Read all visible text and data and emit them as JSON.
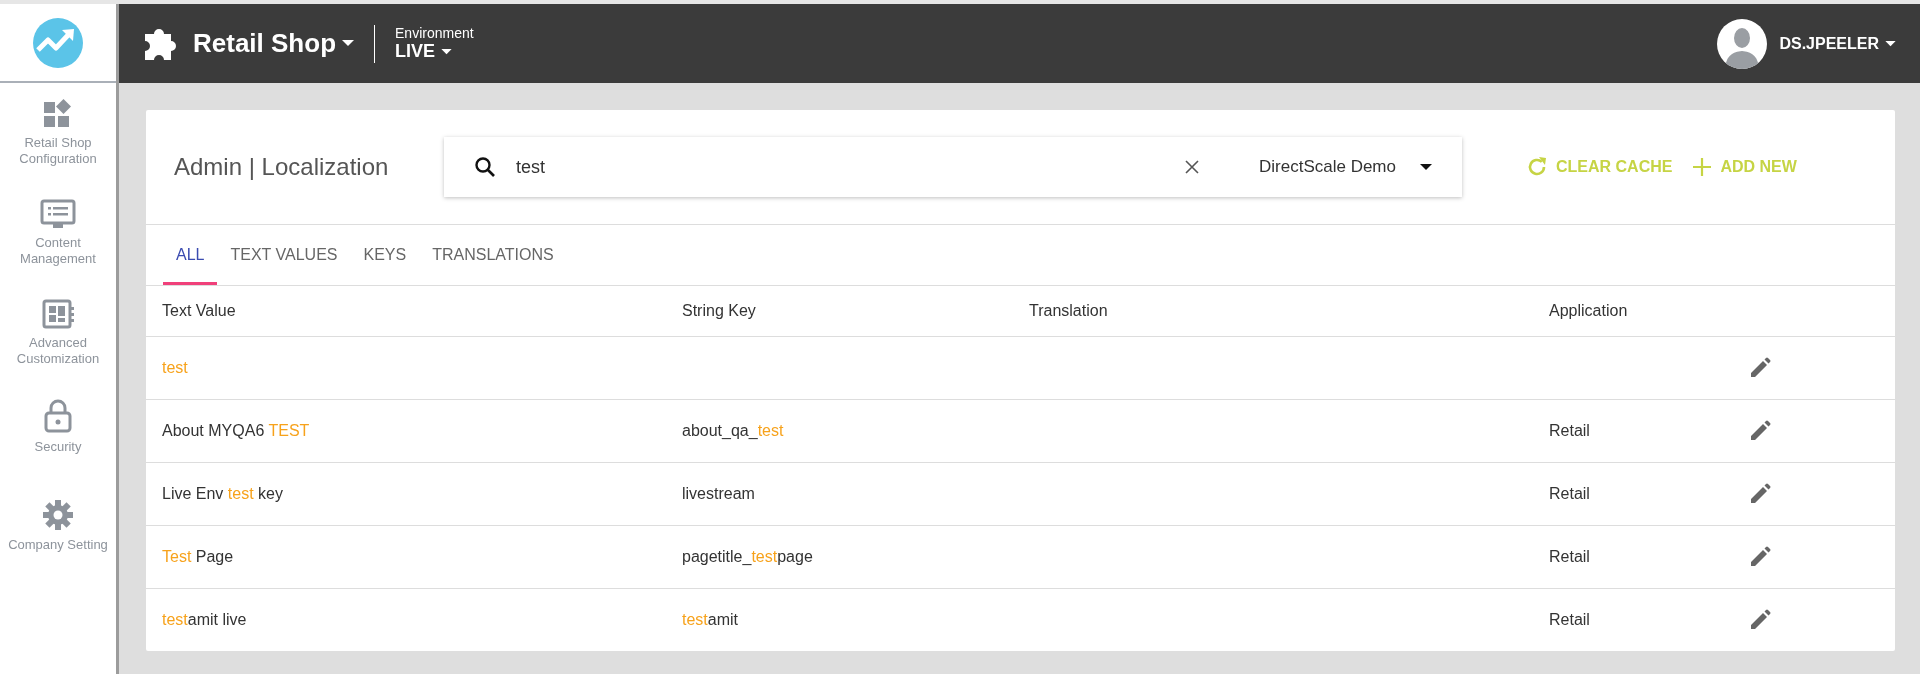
{
  "sidebar": {
    "items": [
      {
        "kind": "widgets",
        "label": "Retail Shop Configuration"
      },
      {
        "kind": "monitor",
        "label": "Content Management"
      },
      {
        "kind": "dashboard",
        "label": "Advanced Customization"
      },
      {
        "kind": "lock",
        "label": "Security"
      },
      {
        "kind": "gear",
        "label": "Company Setting"
      }
    ]
  },
  "header": {
    "app_name": "Retail Shop",
    "environment_label": "Environment",
    "environment": "LIVE",
    "user": "DS.JPEELER"
  },
  "page": {
    "title": "Admin | Localization",
    "search": {
      "value": "test"
    },
    "company_select": "DirectScale Demo",
    "actions": [
      {
        "kind": "refresh",
        "label": "CLEAR CACHE"
      },
      {
        "kind": "add",
        "label": "ADD NEW"
      }
    ]
  },
  "tabs": [
    {
      "label": "ALL",
      "selected": true
    },
    {
      "label": "TEXT VALUES",
      "selected": false
    },
    {
      "label": "KEYS",
      "selected": false
    },
    {
      "label": "TRANSLATIONS",
      "selected": false
    }
  ],
  "table": {
    "columns": [
      "Text Value",
      "String Key",
      "Translation",
      "Application"
    ],
    "rows": [
      {
        "text_value": [
          {
            "text": "test",
            "highlight": true
          }
        ]
      },
      {
        "text_value": [
          {
            "text": "About MYQA6 ",
            "highlight": false
          },
          {
            "text": "TEST",
            "highlight": true
          }
        ],
        "string_key": [
          {
            "text": "about_qa_",
            "highlight": false
          },
          {
            "text": "test",
            "highlight": true
          }
        ],
        "application": "Retail"
      },
      {
        "text_value": [
          {
            "text": "Live Env ",
            "highlight": false
          },
          {
            "text": "test",
            "highlight": true
          },
          {
            "text": " key",
            "highlight": false
          }
        ],
        "string_key": [
          {
            "text": "livestream",
            "highlight": false
          }
        ],
        "application": "Retail"
      },
      {
        "text_value": [
          {
            "text": "Test",
            "highlight": true
          },
          {
            "text": " Page",
            "highlight": false
          }
        ],
        "string_key": [
          {
            "text": "pagetitle_",
            "highlight": false
          },
          {
            "text": "test",
            "highlight": true
          },
          {
            "text": "page",
            "highlight": false
          }
        ],
        "application": "Retail"
      },
      {
        "text_value": [
          {
            "text": "test",
            "highlight": true
          },
          {
            "text": "amit live",
            "highlight": false
          }
        ],
        "string_key": [
          {
            "text": "test",
            "highlight": true
          },
          {
            "text": "amit",
            "highlight": false
          }
        ],
        "application": "Retail"
      }
    ]
  }
}
